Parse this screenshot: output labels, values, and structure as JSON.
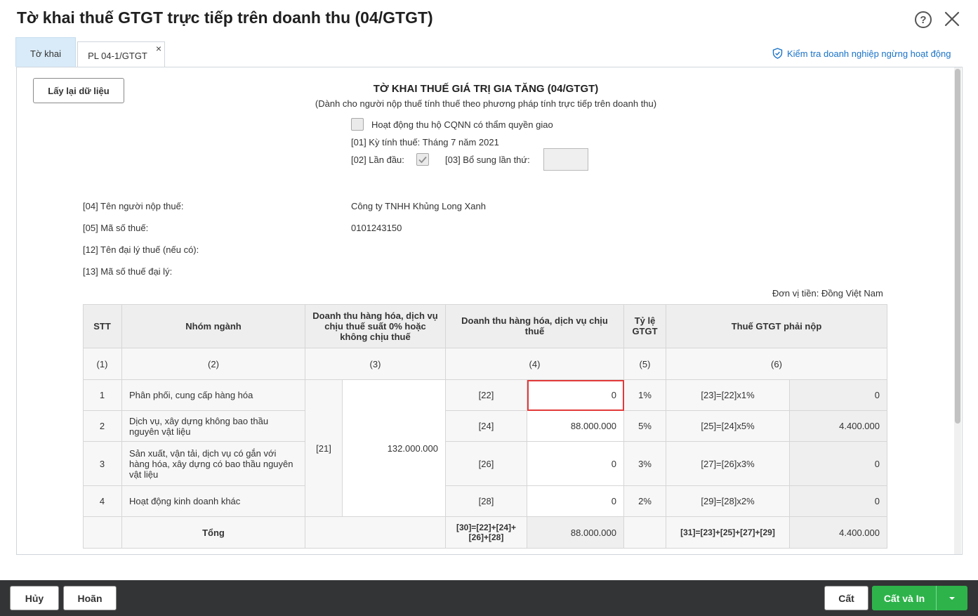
{
  "window": {
    "title": "Tờ khai thuế GTGT trực tiếp trên doanh thu (04/GTGT)",
    "help_symbol": "?"
  },
  "tabs": [
    {
      "label": "Tờ khai"
    },
    {
      "label": "PL 04-1/GTGT",
      "close": "×"
    }
  ],
  "check_link": {
    "label": "Kiểm tra doanh nghiệp ngừng hoạt động"
  },
  "reload_button": {
    "label": "Lấy lại dữ liệu"
  },
  "form": {
    "title": "TỜ KHAI THUẾ GIÁ TRỊ GIA TĂNG (04/GTGT)",
    "subtitle": "(Dành cho người nộp thuế tính thuế theo phương pháp tính trực tiếp trên doanh thu)",
    "collect_label": "Hoạt động thu hộ CQNN có thẩm quyền giao",
    "period": "[01] Kỳ tính thuế: Tháng 7 năm 2021",
    "first_time_label": "[02] Lần đầu:",
    "supplement_label": "[03] Bổ sung lần thứ:"
  },
  "info": {
    "taxpayer_label": "[04] Tên người nộp thuế:",
    "taxpayer_value": "Công ty TNHH Khủng Long Xanh",
    "tax_code_label": "[05] Mã số thuế:",
    "tax_code_value": "0101243150",
    "agent_label": "[12] Tên đại lý thuế (nếu có):",
    "agent_code_label": "[13] Mã số thuế đại lý:",
    "currency": "Đơn vị tiền: Đồng Việt Nam"
  },
  "table": {
    "headers": {
      "stt": "STT",
      "group": "Nhóm ngành",
      "zero": "Doanh thu hàng hóa, dịch vụ chịu thuế suất 0% hoặc không chịu thuế",
      "taxable": "Doanh thu hàng hóa, dịch vụ chịu thuế",
      "rate": "Tỷ lệ GTGT",
      "vat": "Thuế GTGT phải nộp"
    },
    "col_nums": [
      "(1)",
      "(2)",
      "(3)",
      "(4)",
      "(5)",
      "(6)"
    ],
    "zero_code": "[21]",
    "zero_value": "132.000.000",
    "rows": [
      {
        "stt": "1",
        "group": "Phân phối, cung cấp hàng hóa",
        "code": "[22]",
        "revenue": "0",
        "rate": "1%",
        "formula": "[23]=[22]x1%",
        "vat": "0"
      },
      {
        "stt": "2",
        "group": "Dịch vụ, xây dựng không bao thầu nguyên vật liệu",
        "code": "[24]",
        "revenue": "88.000.000",
        "rate": "5%",
        "formula": "[25]=[24]x5%",
        "vat": "4.400.000"
      },
      {
        "stt": "3",
        "group": "Sản xuất, vận tải, dịch vụ có gắn với hàng hóa, xây dựng có bao thầu nguyên vật liệu",
        "code": "[26]",
        "revenue": "0",
        "rate": "3%",
        "formula": "[27]=[26]x3%",
        "vat": "0"
      },
      {
        "stt": "4",
        "group": "Hoạt động kinh doanh khác",
        "code": "[28]",
        "revenue": "0",
        "rate": "2%",
        "formula": "[29]=[28]x2%",
        "vat": "0"
      }
    ],
    "total": {
      "label": "Tổng",
      "code": "[30]=[22]+[24]+[26]+[28]",
      "revenue": "88.000.000",
      "formula": "[31]=[23]+[25]+[27]+[29]",
      "vat": "4.400.000"
    }
  },
  "footer": {
    "cancel": "Hủy",
    "undo": "Hoãn",
    "save": "Cất",
    "save_print": "Cất và In"
  }
}
